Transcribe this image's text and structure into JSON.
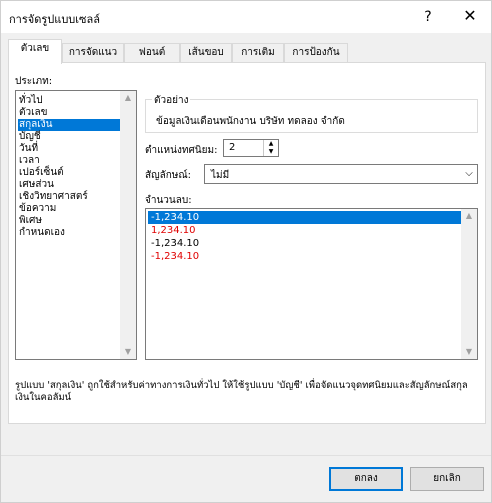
{
  "window": {
    "title": "การจัดรูปแบบเซลล์",
    "help_label": "?",
    "close_label": "✕"
  },
  "tabs": [
    {
      "label": "ตัวเลข",
      "active": true
    },
    {
      "label": "การจัดแนว",
      "active": false
    },
    {
      "label": "ฟอนต์",
      "active": false
    },
    {
      "label": "เส้นขอบ",
      "active": false
    },
    {
      "label": "การเติม",
      "active": false
    },
    {
      "label": "การป้องกัน",
      "active": false
    }
  ],
  "category": {
    "label": "ประเภท:",
    "items": [
      "ทั่วไป",
      "ตัวเลข",
      "สกุลเงิน",
      "บัญชี",
      "วันที่",
      "เวลา",
      "เปอร์เซ็นต์",
      "เศษส่วน",
      "เชิงวิทยาศาสตร์",
      "ข้อความ",
      "พิเศษ",
      "กำหนดเอง"
    ],
    "selected_index": 2
  },
  "sample": {
    "legend": "ตัวอย่าง",
    "value": "ข้อมูลเงินเดือนพนักงาน บริษัท ทดลอง จำกัด"
  },
  "decimal_places": {
    "label": "ตำแหน่งทศนิยม:",
    "value": "2"
  },
  "symbol": {
    "label": "สัญลักษณ์:",
    "value": "ไม่มี"
  },
  "negative_numbers": {
    "label": "จำนวนลบ:",
    "items": [
      {
        "text": "-1,234.10",
        "red": false,
        "selected": true
      },
      {
        "text": "1,234.10",
        "red": true,
        "selected": false
      },
      {
        "text": "-1,234.10",
        "red": false,
        "selected": false
      },
      {
        "text": "-1,234.10",
        "red": true,
        "selected": false
      }
    ]
  },
  "description": "รูปแบบ 'สกุลเงิน' ถูกใช้สำหรับค่าทางการเงินทั่วไป ให้ใช้รูปแบบ 'บัญชี' เพื่อจัดแนวจุดทศนิยมและสัญลักษณ์สกุลเงินในคอลัมน์",
  "buttons": {
    "ok_label": "ตกลง",
    "cancel_label": "ยกเลิก"
  },
  "colors": {
    "selection": "#0078d7",
    "negative_red": "#e00000",
    "dialog_bg": "#f0f0f0"
  }
}
